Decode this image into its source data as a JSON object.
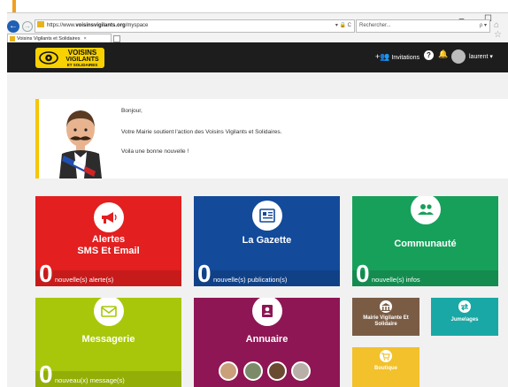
{
  "browser": {
    "address": {
      "scheme": "https://www.",
      "domain": "voisinsvigilants.org",
      "path": "/myspace",
      "tools": "▾ 🔒 C"
    },
    "search_placeholder": "Rechercher...",
    "search_tools": "ρ ▾",
    "tab_title": "Voisins Vigilants et Solidaires",
    "tab_close": "×",
    "window_controls": "–  ☐"
  },
  "nav": {
    "logo": {
      "line1": "VOISINS",
      "line2": "VIGILANTS",
      "line3": "ET SOLIDAIRES"
    },
    "invite_label": "Invitations",
    "help": "?",
    "username": "laurent ▾",
    "icons": [
      "add-user-icon",
      "help-icon",
      "bell-icon",
      "avatar",
      "caret-down-icon"
    ]
  },
  "welcome": {
    "line1": "Bonjour,",
    "line2": "Votre Mairie soutient l'action des Voisins Vigilants et Solidaires.",
    "line3": "Voila une bonne nouvelle !"
  },
  "tiles": {
    "alerts": {
      "title1": "Alertes",
      "title2": "SMS Et Email",
      "count": "0",
      "label": "nouvelle(s) alerte(s)",
      "color": "#e31f1f"
    },
    "gazette": {
      "title": "La Gazette",
      "count": "0",
      "label": "nouvelle(s) publication(s)",
      "color": "#134a9a"
    },
    "communaute": {
      "title": "Communauté",
      "count": "0",
      "label": "nouvelle(s) infos",
      "color": "#17a05a"
    },
    "messagerie": {
      "title": "Messagerie",
      "count": "0",
      "label": "nouveau(x) message(s)",
      "color": "#a9c70a"
    },
    "annuaire": {
      "title": "Annuaire",
      "color": "#8e1654"
    },
    "mairie": {
      "title1": "Mairie Vigilante Et",
      "title2": "Solidaire",
      "color": "#7a5c45"
    },
    "jumelages": {
      "title": "Jumelages",
      "color": "#19a8a5"
    },
    "boutique": {
      "title": "Boutique",
      "color": "#f2c12b"
    }
  }
}
